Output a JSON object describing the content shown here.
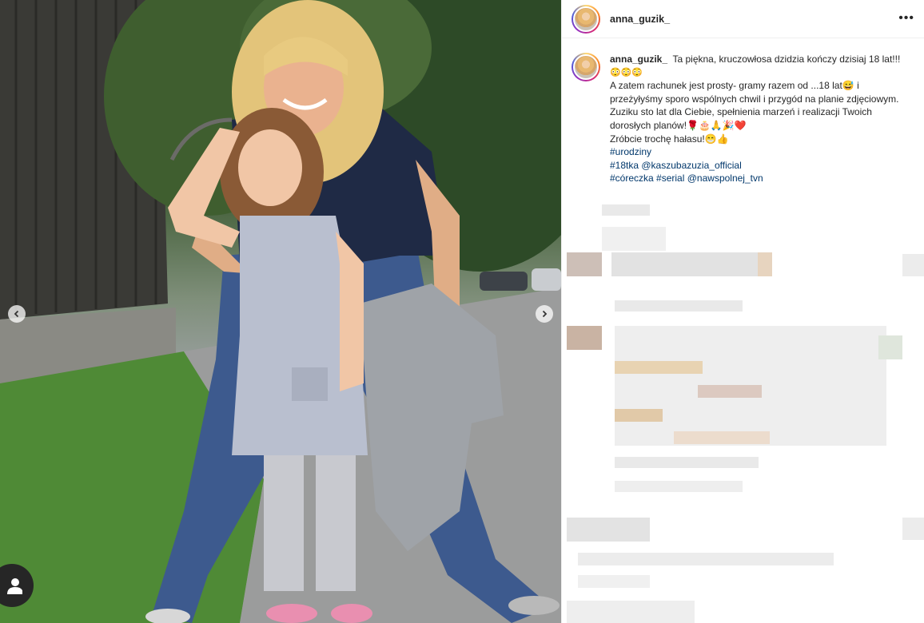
{
  "post": {
    "username": "anna_guzik_",
    "more_label": "•••",
    "caption": {
      "username": "anna_guzik_",
      "line1": "Ta piękna, kruczowłosa dzidzia kończy dzisiaj 18 lat!!!",
      "line1_emoji": "😳😳😳",
      "line2": "A zatem rachunek jest prosty- gramy razem od ...18 lat😅 i przeżyłyśmy sporo wspólnych chwil i przygód na planie zdjęciowym.",
      "line3": "Zuziku sto lat dla Ciebie, spełnienia marzeń i realizacji Twoich dorosłych planów!🌹🎂🙏🎉❤️",
      "line4": "Zróbcie trochę hałasu!😁👍",
      "hashtag1": "#urodziny",
      "hashtag2": "#18tka",
      "mention1": "@kaszubazuzia_official",
      "hashtag3": "#córeczka",
      "hashtag4": "#serial",
      "mention2": "@nawspolnej_tvn"
    }
  },
  "icons": {
    "prev": "chevron-left-icon",
    "next": "chevron-right-icon",
    "tag": "user-tag-icon",
    "more": "more-dots-icon"
  },
  "colors": {
    "link": "#00376b",
    "text": "#262626",
    "border": "#efefef"
  }
}
